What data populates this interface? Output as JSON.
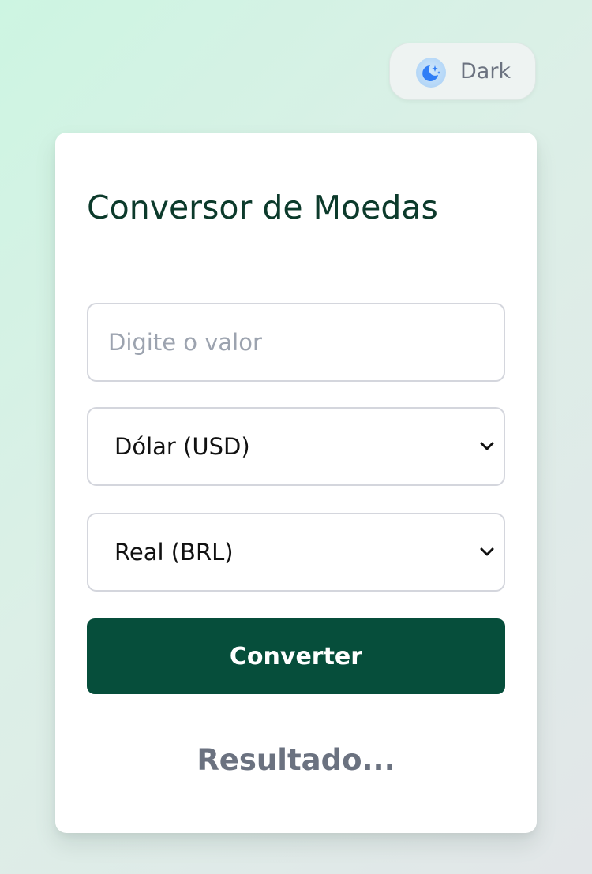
{
  "theme_toggle": {
    "label": "Dark",
    "icon": "moon-stars-icon"
  },
  "converter": {
    "title": "Conversor de Moedas",
    "amount_placeholder": "Digite o valor",
    "from_currency": "Dólar (USD)",
    "to_currency": "Real (BRL)",
    "convert_label": "Converter",
    "result_text": "Resultado..."
  },
  "colors": {
    "primary": "#064e3b",
    "title": "#0c3a2b",
    "muted": "#6b7280",
    "placeholder": "#9ca3af"
  }
}
